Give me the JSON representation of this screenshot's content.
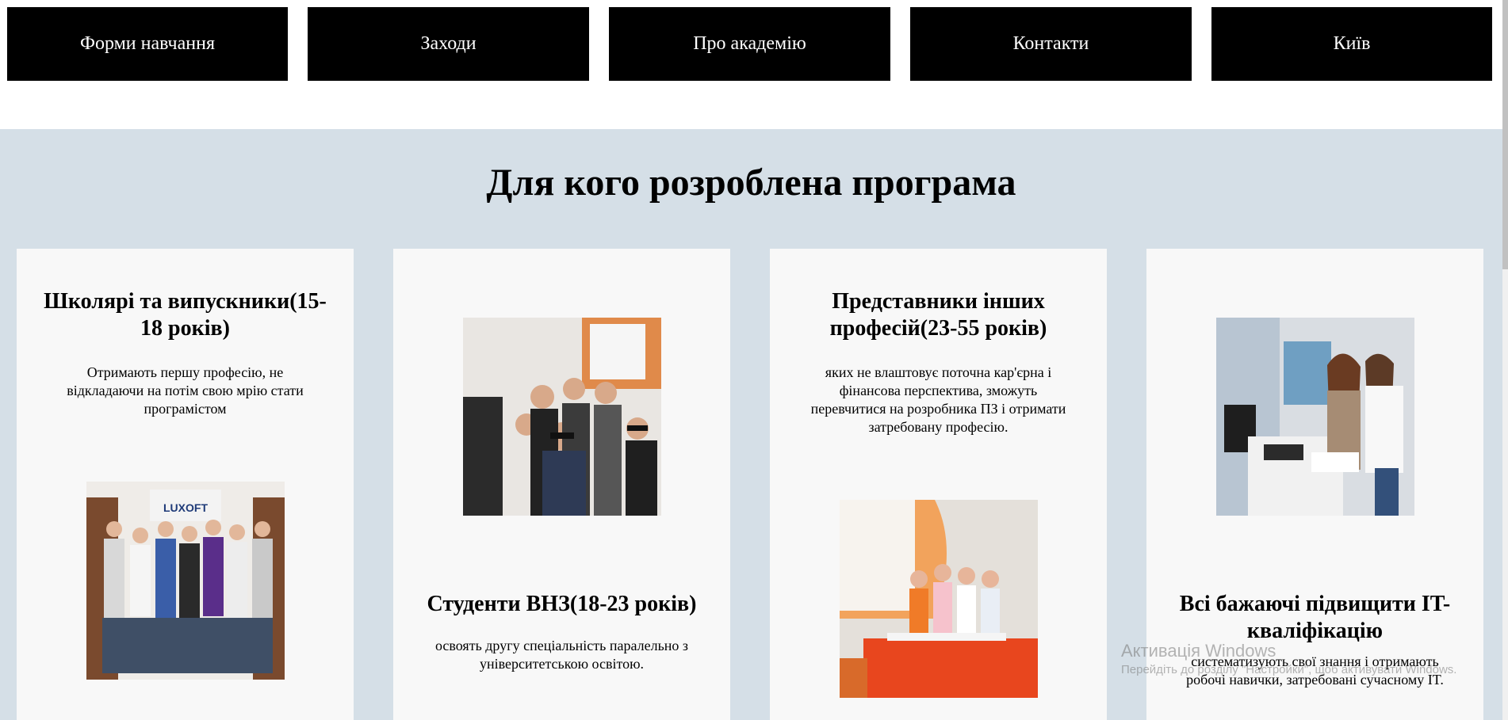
{
  "nav": {
    "items": [
      {
        "label": "Форми навчання"
      },
      {
        "label": "Заходи"
      },
      {
        "label": "Про академію"
      },
      {
        "label": "Контакти"
      },
      {
        "label": "Київ"
      }
    ]
  },
  "section": {
    "title": "Для кого розроблена програма",
    "cards": [
      {
        "title": "Школярі та випускники(15-18 років)",
        "text": "Отримають першу професію, не відкладаючи на потім свою мрію стати програмістом"
      },
      {
        "title": "Студенти ВНЗ(18-23 років)",
        "text": "освоять другу спеціальність паралельно з університетською освітою."
      },
      {
        "title": "Представники інших професій(23-55 років)",
        "text": "яких не влаштовує поточна кар'єрна і фінансова перспектива, зможуть перевчитися на розробника ПЗ і отримати затребовану професію."
      },
      {
        "title": "Всі бажаючі підвищити IT-кваліфікацію",
        "text": "систематизують свої знання і отримають робочі навички, затребовані сучасному IT."
      }
    ]
  },
  "watermark": {
    "title": "Активація Windows",
    "subtitle": "Перейдіть до розділу \"Настройки\", щоб активувати Windows."
  },
  "colors": {
    "nav_bg": "#000000",
    "nav_text": "#ffffff",
    "section_bg": "#d5dfe7",
    "card_bg": "#f8f8f8"
  },
  "images": {
    "luxoft_logo_text": "LUXOFT"
  }
}
